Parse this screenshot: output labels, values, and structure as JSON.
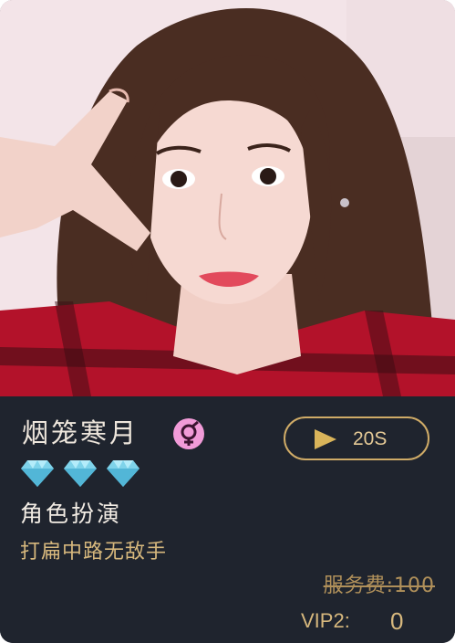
{
  "profile": {
    "photo_icon": "portrait-photo",
    "name": "烟笼寒月",
    "gender_icon": "female-symbol-icon",
    "gem_icon": "diamond-icon",
    "gem_count": 3,
    "role": "角色扮演",
    "slogan": "打扁中路无敌手"
  },
  "voice": {
    "play_icon": "play-triangle-icon",
    "duration": "20S"
  },
  "pricing": {
    "service_fee": "服务费:100",
    "vip_label": "VIP2:",
    "vip_price": "0"
  },
  "colors": {
    "background": "#1f242e",
    "gold": "#d7b87d",
    "gender_badge": "#f19bd8",
    "gem": "#79cfe6"
  }
}
